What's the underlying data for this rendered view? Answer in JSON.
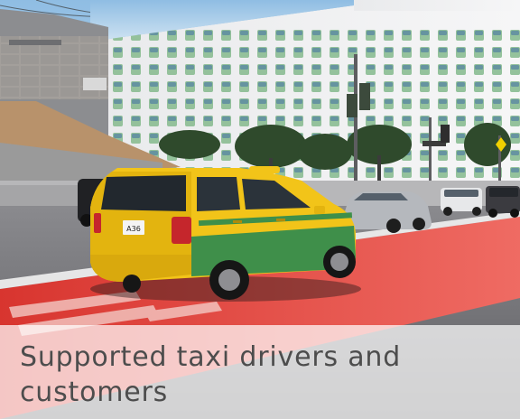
{
  "caption": "Supported taxi drivers and customers",
  "photo": {
    "taxi_plate": "A36",
    "colors": {
      "sky": "#9ec6e6",
      "building": "#ecedef",
      "window_green": "#7fb58a",
      "taxi_yellow": "#f0c419",
      "taxi_green": "#3f8f4a",
      "bus_lane_red": "#e2443f",
      "road": "#6f6f73"
    }
  }
}
